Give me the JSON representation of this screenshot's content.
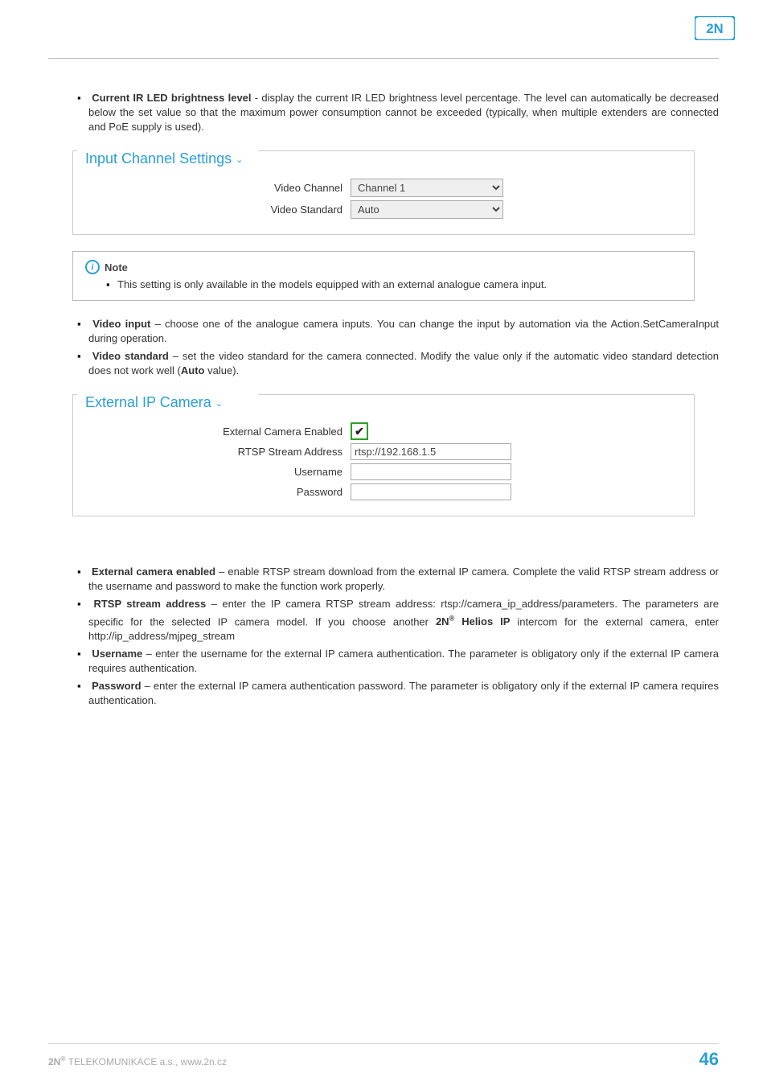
{
  "logo_alt": "2N",
  "bullet1": {
    "title": "Current IR LED brightness level",
    "text": " - display the current IR LED brightness level percentage. The level can automatically be decreased below the set value so that the maximum power consumption cannot be exceeded (typically, when multiple extenders are connected and PoE supply is used)."
  },
  "input_channel_settings": {
    "legend": "Input Channel Settings",
    "video_channel_label": "Video Channel",
    "video_channel_value": "Channel 1",
    "video_standard_label": "Video Standard",
    "video_standard_value": "Auto"
  },
  "note": {
    "label": "Note",
    "text": "This setting is only available in the models equipped with an external analogue camera input."
  },
  "bullets2": {
    "video_input_title": "Video input",
    "video_input_text": " – choose one of the analogue camera inputs. You can change the input by automation via the Action.SetCameraInput during operation.",
    "video_standard_title": "Video standard",
    "video_standard_text_a": " – set the video standard for the camera connected. Modify the value only if the automatic video standard detection does not work well (",
    "video_standard_auto": "Auto",
    "video_standard_text_b": " value)."
  },
  "external_ip_camera": {
    "legend": "External IP Camera",
    "enabled_label": "External Camera Enabled",
    "enabled_value": true,
    "rtsp_label": "RTSP Stream Address",
    "rtsp_value": "rtsp://192.168.1.5",
    "username_label": "Username",
    "username_value": "",
    "password_label": "Password",
    "password_value": ""
  },
  "bullets3": {
    "external_cam_title": "External camera enabled",
    "external_cam_text": " – enable RTSP stream download from the external IP camera. Complete the valid RTSP stream address or the username and password to make the function work properly.",
    "rtsp_title": "RTSP stream address",
    "rtsp_text_a": " – enter the IP camera RTSP stream address: rtsp://camera_ip_address/parameters. The parameters are specific for the selected IP camera model. If you choose another ",
    "rtsp_2n": "2N",
    "rtsp_helios": " Helios IP",
    "rtsp_text_b": " intercom for the external camera, enter http://ip_address/mjpeg_stream",
    "username_title": "Username",
    "username_text": " – enter the username for the external IP camera authentication. The parameter is obligatory only if the external IP camera requires authentication.",
    "password_title": "Password",
    "password_text": " – enter the external IP camera authentication password. The parameter is obligatory only if the external IP camera requires authentication."
  },
  "footer": {
    "left_a": "2N",
    "left_b": " TELEKOMUNIKACE a.s., www.2n.cz",
    "page": "46"
  }
}
